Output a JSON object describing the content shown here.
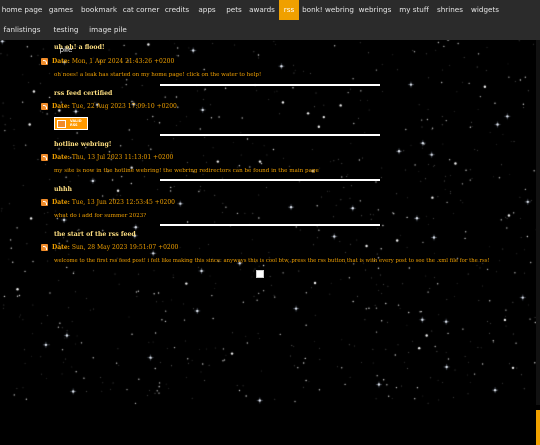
{
  "nav": {
    "items": [
      "home page",
      "games",
      "bookmark",
      "cat corner",
      "credits",
      "apps",
      "pets",
      "awards",
      "rss",
      "bonk! webring",
      "webrings",
      "my stuff",
      "shrines",
      "widgets",
      "fanlistings",
      "testing pile",
      "image pile"
    ],
    "active": "rss"
  },
  "feed": {
    "date_label": "Date:",
    "posts": [
      {
        "title": "uh oh! a flood!",
        "date": "Mon, 1 Apr 2024 21:43:26 +0200",
        "description": "oh noes! a leak has started on my home page! click on the water to help!"
      },
      {
        "title": "rss feed certified",
        "date": "Tue, 22 Aug 2023 17:09:10 +0200",
        "description": "",
        "badge": "VALID RSS"
      },
      {
        "title": "hotline webring!",
        "date": "Thu, 13 Jul 2023 11:13:01 +0200",
        "description": "my site is now in the hotline webring! the webring redirectors can be found in the main page"
      },
      {
        "title": "uhhh",
        "date": "Tue, 13 Jun 2023 12:53:45 +0200",
        "description": "what do i add for summer 2023?"
      },
      {
        "title": "the start of the rss feed",
        "date": "Sun, 28 May 2023 19:51:07 +0200",
        "description": "welcome to the first rss feed post! i felt like making this since: anyways this is cool btw, press the rss button that is with every post to see the .xml file for the rss!"
      }
    ]
  },
  "colors": {
    "accent": "#f0a000",
    "title": "#ffe082",
    "nav_bg": "#2b2b2b",
    "bg": "#000000"
  }
}
